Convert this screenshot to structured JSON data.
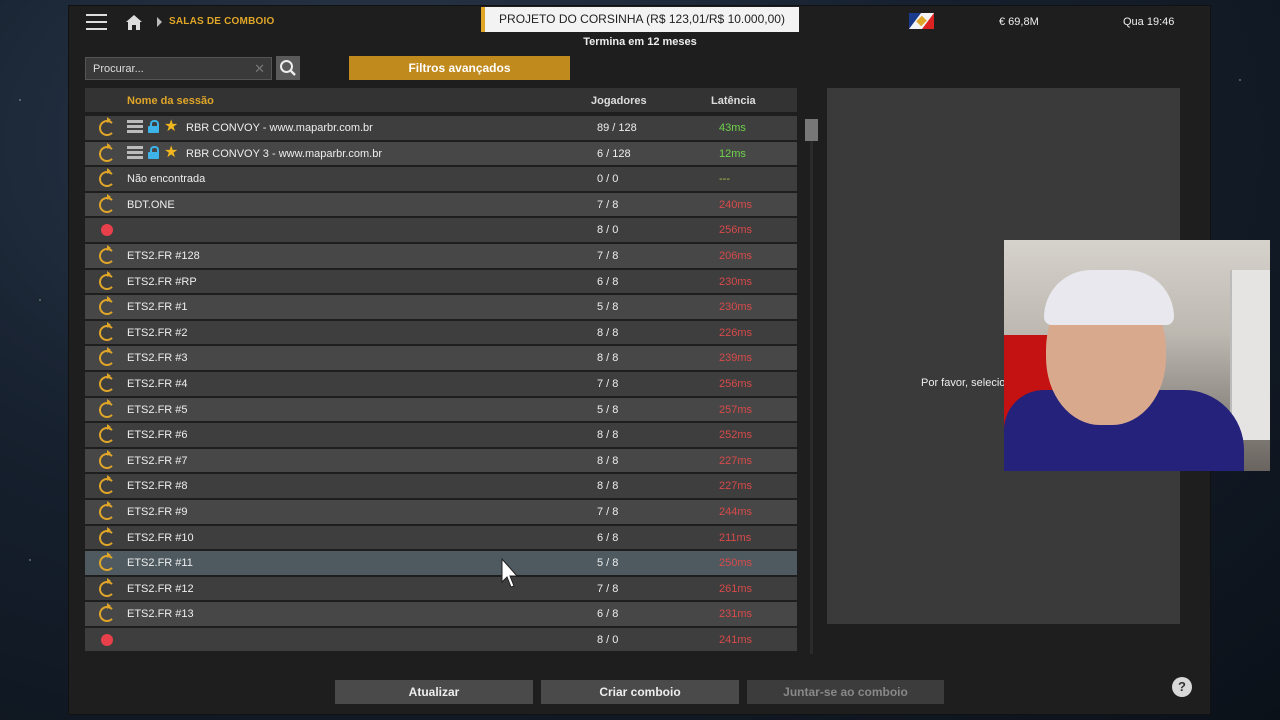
{
  "topbar": {
    "breadcrumb": "SALAS DE COMBOIO",
    "job_title": "PROJETO DO CORSINHA (R$ 123,01/R$ 10.000,00)",
    "job_subtitle": "Termina em 12 meses",
    "money": "€ 69,8M",
    "clock": "Qua 19:46"
  },
  "search": {
    "placeholder": "Procurar..."
  },
  "filters_label": "Filtros avançados",
  "table": {
    "headers": {
      "name": "Nome da sessão",
      "players": "Jogadores",
      "latency": "Latência"
    },
    "rows": [
      {
        "name": "RBR CONVOY - www.maparbr.com.br",
        "players": "89 / 128",
        "latency": "43ms"
      },
      {
        "name": "RBR CONVOY 3 - www.maparbr.com.br",
        "players": "6 / 128",
        "latency": "12ms"
      },
      {
        "name": "Não encontrada",
        "players": "0 / 0",
        "latency": "---"
      },
      {
        "name": "BDT.ONE",
        "players": "7 / 8",
        "latency": "240ms"
      },
      {
        "name": "",
        "players": "8 / 0",
        "latency": "256ms"
      },
      {
        "name": "ETS2.FR #128",
        "players": "7 / 8",
        "latency": "206ms"
      },
      {
        "name": "ETS2.FR #RP",
        "players": "6 / 8",
        "latency": "230ms"
      },
      {
        "name": "ETS2.FR #1",
        "players": "5 / 8",
        "latency": "230ms"
      },
      {
        "name": "ETS2.FR #2",
        "players": "8 / 8",
        "latency": "226ms"
      },
      {
        "name": "ETS2.FR #3",
        "players": "8 / 8",
        "latency": "239ms"
      },
      {
        "name": "ETS2.FR #4",
        "players": "7 / 8",
        "latency": "256ms"
      },
      {
        "name": "ETS2.FR #5",
        "players": "5 / 8",
        "latency": "257ms"
      },
      {
        "name": "ETS2.FR #6",
        "players": "8 / 8",
        "latency": "252ms"
      },
      {
        "name": "ETS2.FR #7",
        "players": "8 / 8",
        "latency": "227ms"
      },
      {
        "name": "ETS2.FR #8",
        "players": "8 / 8",
        "latency": "227ms"
      },
      {
        "name": "ETS2.FR #9",
        "players": "7 / 8",
        "latency": "244ms"
      },
      {
        "name": "ETS2.FR #10",
        "players": "6 / 8",
        "latency": "211ms"
      },
      {
        "name": "ETS2.FR #11",
        "players": "5 / 8",
        "latency": "250ms"
      },
      {
        "name": "ETS2.FR #12",
        "players": "7 / 8",
        "latency": "261ms"
      },
      {
        "name": "ETS2.FR #13",
        "players": "6 / 8",
        "latency": "231ms"
      },
      {
        "name": "",
        "players": "8 / 0",
        "latency": "241ms"
      }
    ]
  },
  "detail": {
    "text": "Por favor, selecio"
  },
  "buttons": {
    "refresh": "Atualizar",
    "create": "Criar comboio",
    "join": "Juntar-se ao comboio",
    "help": "?"
  },
  "colors": {
    "accent": "#e0a628",
    "latency_good": "#6fd24a",
    "latency_bad": "#d84a4a",
    "status_offline": "#e8404a",
    "lock": "#3db3e8"
  }
}
